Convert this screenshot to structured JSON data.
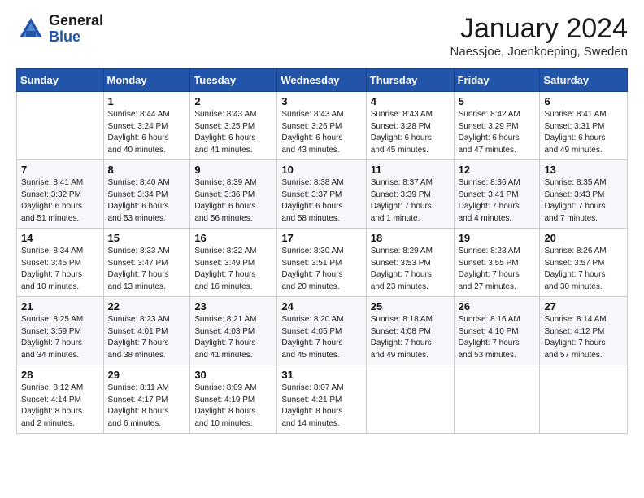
{
  "header": {
    "logo_general": "General",
    "logo_blue": "Blue",
    "month_title": "January 2024",
    "location": "Naessjoe, Joenkoeping, Sweden"
  },
  "weekdays": [
    "Sunday",
    "Monday",
    "Tuesday",
    "Wednesday",
    "Thursday",
    "Friday",
    "Saturday"
  ],
  "weeks": [
    [
      {
        "day": "",
        "info": ""
      },
      {
        "day": "1",
        "info": "Sunrise: 8:44 AM\nSunset: 3:24 PM\nDaylight: 6 hours\nand 40 minutes."
      },
      {
        "day": "2",
        "info": "Sunrise: 8:43 AM\nSunset: 3:25 PM\nDaylight: 6 hours\nand 41 minutes."
      },
      {
        "day": "3",
        "info": "Sunrise: 8:43 AM\nSunset: 3:26 PM\nDaylight: 6 hours\nand 43 minutes."
      },
      {
        "day": "4",
        "info": "Sunrise: 8:43 AM\nSunset: 3:28 PM\nDaylight: 6 hours\nand 45 minutes."
      },
      {
        "day": "5",
        "info": "Sunrise: 8:42 AM\nSunset: 3:29 PM\nDaylight: 6 hours\nand 47 minutes."
      },
      {
        "day": "6",
        "info": "Sunrise: 8:41 AM\nSunset: 3:31 PM\nDaylight: 6 hours\nand 49 minutes."
      }
    ],
    [
      {
        "day": "7",
        "info": "Sunrise: 8:41 AM\nSunset: 3:32 PM\nDaylight: 6 hours\nand 51 minutes."
      },
      {
        "day": "8",
        "info": "Sunrise: 8:40 AM\nSunset: 3:34 PM\nDaylight: 6 hours\nand 53 minutes."
      },
      {
        "day": "9",
        "info": "Sunrise: 8:39 AM\nSunset: 3:36 PM\nDaylight: 6 hours\nand 56 minutes."
      },
      {
        "day": "10",
        "info": "Sunrise: 8:38 AM\nSunset: 3:37 PM\nDaylight: 6 hours\nand 58 minutes."
      },
      {
        "day": "11",
        "info": "Sunrise: 8:37 AM\nSunset: 3:39 PM\nDaylight: 7 hours\nand 1 minute."
      },
      {
        "day": "12",
        "info": "Sunrise: 8:36 AM\nSunset: 3:41 PM\nDaylight: 7 hours\nand 4 minutes."
      },
      {
        "day": "13",
        "info": "Sunrise: 8:35 AM\nSunset: 3:43 PM\nDaylight: 7 hours\nand 7 minutes."
      }
    ],
    [
      {
        "day": "14",
        "info": "Sunrise: 8:34 AM\nSunset: 3:45 PM\nDaylight: 7 hours\nand 10 minutes."
      },
      {
        "day": "15",
        "info": "Sunrise: 8:33 AM\nSunset: 3:47 PM\nDaylight: 7 hours\nand 13 minutes."
      },
      {
        "day": "16",
        "info": "Sunrise: 8:32 AM\nSunset: 3:49 PM\nDaylight: 7 hours\nand 16 minutes."
      },
      {
        "day": "17",
        "info": "Sunrise: 8:30 AM\nSunset: 3:51 PM\nDaylight: 7 hours\nand 20 minutes."
      },
      {
        "day": "18",
        "info": "Sunrise: 8:29 AM\nSunset: 3:53 PM\nDaylight: 7 hours\nand 23 minutes."
      },
      {
        "day": "19",
        "info": "Sunrise: 8:28 AM\nSunset: 3:55 PM\nDaylight: 7 hours\nand 27 minutes."
      },
      {
        "day": "20",
        "info": "Sunrise: 8:26 AM\nSunset: 3:57 PM\nDaylight: 7 hours\nand 30 minutes."
      }
    ],
    [
      {
        "day": "21",
        "info": "Sunrise: 8:25 AM\nSunset: 3:59 PM\nDaylight: 7 hours\nand 34 minutes."
      },
      {
        "day": "22",
        "info": "Sunrise: 8:23 AM\nSunset: 4:01 PM\nDaylight: 7 hours\nand 38 minutes."
      },
      {
        "day": "23",
        "info": "Sunrise: 8:21 AM\nSunset: 4:03 PM\nDaylight: 7 hours\nand 41 minutes."
      },
      {
        "day": "24",
        "info": "Sunrise: 8:20 AM\nSunset: 4:05 PM\nDaylight: 7 hours\nand 45 minutes."
      },
      {
        "day": "25",
        "info": "Sunrise: 8:18 AM\nSunset: 4:08 PM\nDaylight: 7 hours\nand 49 minutes."
      },
      {
        "day": "26",
        "info": "Sunrise: 8:16 AM\nSunset: 4:10 PM\nDaylight: 7 hours\nand 53 minutes."
      },
      {
        "day": "27",
        "info": "Sunrise: 8:14 AM\nSunset: 4:12 PM\nDaylight: 7 hours\nand 57 minutes."
      }
    ],
    [
      {
        "day": "28",
        "info": "Sunrise: 8:12 AM\nSunset: 4:14 PM\nDaylight: 8 hours\nand 2 minutes."
      },
      {
        "day": "29",
        "info": "Sunrise: 8:11 AM\nSunset: 4:17 PM\nDaylight: 8 hours\nand 6 minutes."
      },
      {
        "day": "30",
        "info": "Sunrise: 8:09 AM\nSunset: 4:19 PM\nDaylight: 8 hours\nand 10 minutes."
      },
      {
        "day": "31",
        "info": "Sunrise: 8:07 AM\nSunset: 4:21 PM\nDaylight: 8 hours\nand 14 minutes."
      },
      {
        "day": "",
        "info": ""
      },
      {
        "day": "",
        "info": ""
      },
      {
        "day": "",
        "info": ""
      }
    ]
  ]
}
